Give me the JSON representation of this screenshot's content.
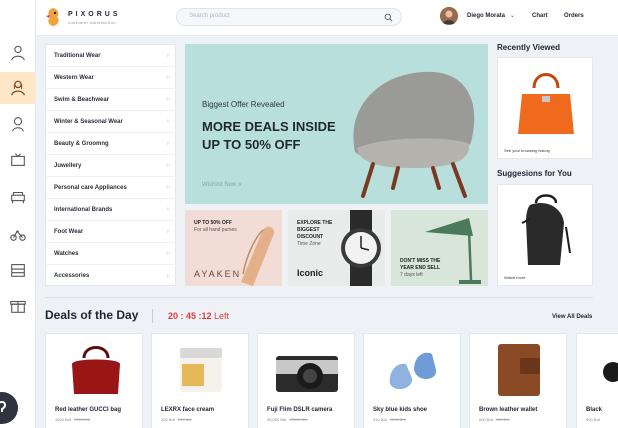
{
  "header": {
    "brand": "PIXORUS",
    "tagline": "customer satisfaction",
    "search_placeholder": "Search product",
    "user_name": "Diego Morata",
    "nav": {
      "chart": "Chart",
      "orders": "Orders"
    }
  },
  "rail": {
    "icons": [
      "man-icon",
      "woman-icon",
      "baby-icon",
      "tv-icon",
      "sofa-icon",
      "bicycle-icon",
      "shelf-icon",
      "gift-icon"
    ],
    "active_index": 1
  },
  "categories": [
    "Traditional Wear",
    "Western Wear",
    "Swim & Beachwear",
    "Winter & Seasonal Wear",
    "Beauty & Groomng",
    "Juwellery",
    "Personal care Appliances",
    "International Brands",
    "Foot Wear",
    "Watches",
    "Accessories"
  ],
  "hero": {
    "kicker": "Biggest Offer Revealed",
    "title": "MORE DEALS INSIDE UP TO 50% OFF",
    "link": "Wishlist Now  »"
  },
  "promos": {
    "first": {
      "title": "UP TO 50% OFF",
      "sub": "For all hand purses",
      "brand": "AYAKEN"
    },
    "second": {
      "title": "EXPLORE THE BIGGEST DISCOUNT",
      "sub": "Time Zone",
      "brand": "Iconic"
    },
    "third": {
      "title": "DON'T MISS THE YEAR END SELL",
      "sub": "7 days left"
    }
  },
  "side": {
    "recent_title": "Recently Viewed",
    "recent_caption": "See your browsing history",
    "suggest_title": "Suggesions for You",
    "suggest_caption": "Watch more"
  },
  "deals": {
    "title": "Deals of the Day",
    "timer": "20 : 45 :12",
    "timer_suffix": "Left",
    "view_all": "View All Deals",
    "products": [
      {
        "name": "Red leather GUCCI bag",
        "price": "4500 Bdt",
        "old": "7300 Bdt"
      },
      {
        "name": "LEXRX face cream",
        "price": "300 Bdt",
        "old": "740 Bdt"
      },
      {
        "name": "Fuji Flim DSLR camera",
        "price": "35,000 Bdt",
        "old": "43000 Bdt"
      },
      {
        "name": "Sky blue kids shoe",
        "price": "910 Bdt",
        "old": "1200 Bdt"
      },
      {
        "name": "Brown leather wallet",
        "price": "600 Bdt",
        "old": "980 Bdt"
      },
      {
        "name": "Black",
        "price": "900 Bdt",
        "old": ""
      }
    ]
  },
  "colors": {
    "accent": "#e0403a",
    "hero_bg": "#b9dfdc",
    "active_rail": "#fde7c8"
  }
}
